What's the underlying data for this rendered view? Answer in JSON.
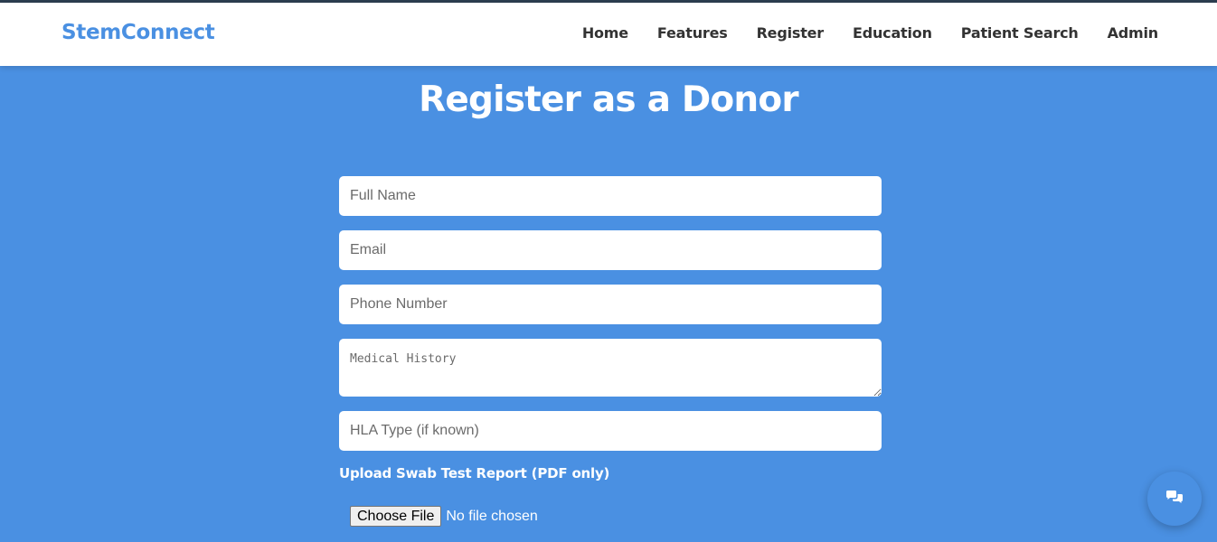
{
  "nav": {
    "brand": "StemConnect",
    "links": [
      "Home",
      "Features",
      "Register",
      "Education",
      "Patient Search",
      "Admin"
    ]
  },
  "page": {
    "title": "Register as a Donor"
  },
  "form": {
    "full_name_placeholder": "Full Name",
    "email_placeholder": "Email",
    "phone_placeholder": "Phone Number",
    "medical_history_placeholder": "Medical History",
    "hla_placeholder": "HLA Type (if known)",
    "upload_label": "Upload Swab Test Report (PDF only)",
    "file_button_label": "Choose File",
    "file_status": "No file chosen"
  },
  "chat": {
    "icon": "chat-bubbles-icon"
  },
  "colors": {
    "background": "#4a90e2",
    "brand": "#4a90e2",
    "navbar": "#ffffff",
    "topline": "#2c3e50"
  }
}
